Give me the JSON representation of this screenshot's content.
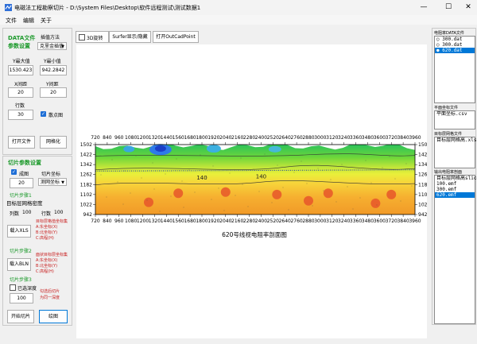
{
  "window": {
    "title": "电磁法工程勘察切片 - D:\\System Files\\Desktop\\软件远程测试\\测试数据1",
    "minimize_glyph": "—",
    "maximize_glyph": "☐",
    "close_glyph": "✕"
  },
  "menu": [
    {
      "label": "文件"
    },
    {
      "label": "编辑"
    },
    {
      "label": "关于"
    }
  ],
  "data_settings": {
    "title_line1": "DATA文件",
    "title_line2": "参数设置",
    "interp_label": "插值方法",
    "interp_value": "克里金插值",
    "ymax_label": "Y最大值",
    "ymax_value": "1530.423",
    "ymin_label": "Y最小值",
    "ymin_value": "942.2842",
    "xstep_label": "X间距",
    "xstep_value": "20",
    "ystep_label": "Y间距",
    "ystep_value": "20",
    "rows_label": "行数",
    "rows_value": "30",
    "pointmap_label": "散点图",
    "open_file_button": "打开文件",
    "mesh_button": "网格化"
  },
  "slice_settings": {
    "title": "切片参数设置",
    "contour_label": "成图",
    "slice_coord_label": "切片坐标",
    "contour_value": "20",
    "slice_coord_value": "测网坐标",
    "step1_title": "切片步骤1",
    "target_mesh_label": "目标层网格密度",
    "cols_label": "列数",
    "cols_value": "100",
    "rows_label": "行数",
    "rows_value": "100",
    "load_xls_button": "载入XLS",
    "xls_note": [
      "目标层格值坐标集",
      "A:东坐标(X)",
      "B:北坐标(Y)",
      "C:高程(H)"
    ],
    "step2_title": "切片步骤2",
    "load_bln_button": "载入BLN",
    "bln_note": [
      "面状目标层坐标集",
      "A:东坐标(X)",
      "B:北坐标(Y)",
      "C:高程(H)"
    ],
    "step3_title": "切片步骤3",
    "step3_value": "100",
    "step3_check_label": "已选深度",
    "note_line1": "勾选后切片",
    "note_line2": "为同一深度",
    "start_button": "开始切片",
    "confirm_button": "绘图"
  },
  "toolbar": {
    "rotate_label": "3D旋转",
    "surfer_button": "Surfer显示/隐藏",
    "outcad_button": "打开OutCadPoint"
  },
  "right_panel": {
    "section_data_label": "电阻率DATA文件",
    "data_files": [
      "300.dat",
      "300.dat",
      "620.dat"
    ],
    "data_files_selected": 2,
    "plane_label": "平面坐标文件",
    "plane_file": "平面坐标.csv",
    "target_label": "目标层网格文件",
    "target_file": "目标层网格高.xls",
    "section_chart_label": "输出电阻率剖面",
    "chart_files": [
      "目标层网格高slice.xls",
      "100.emf",
      "300.emf",
      "620.emf"
    ],
    "chart_files_selected": 3
  },
  "chart_data": {
    "type": "heatmap",
    "title": "620号线视电阻率剖面图",
    "x_ticks": [
      720,
      840,
      960,
      1080,
      1200,
      1320,
      1440,
      1560,
      1680,
      1800,
      1920,
      2040,
      2160,
      2280,
      2400,
      2520,
      2640,
      2760,
      2880,
      3000,
      3120,
      3240,
      3360,
      3480,
      3600,
      3720,
      3840,
      3960
    ],
    "y_ticks": [
      1502,
      1422,
      1342,
      1262,
      1182,
      1102,
      1022,
      942
    ],
    "xlim": [
      720,
      3960
    ],
    "ylim": [
      942,
      1502
    ],
    "contour_labels": [
      {
        "x": 1800,
        "y": 1222,
        "text": "140"
      },
      {
        "x": 2400,
        "y": 1232,
        "text": "140"
      }
    ]
  }
}
